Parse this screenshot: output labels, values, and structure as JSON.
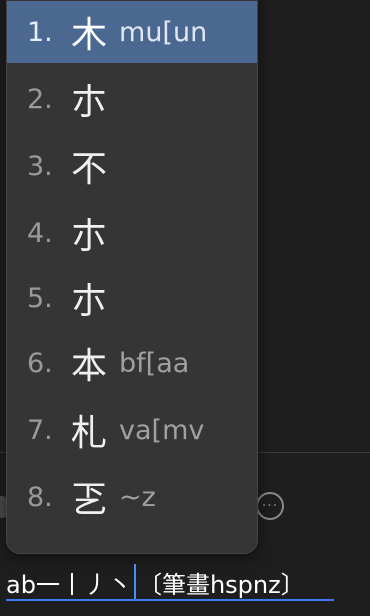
{
  "candidates": [
    {
      "num": "1.",
      "char": "木",
      "code": "mu[un",
      "selected": true
    },
    {
      "num": "2.",
      "char": "朩",
      "code": ""
    },
    {
      "num": "3.",
      "char": "不",
      "code": ""
    },
    {
      "num": "4.",
      "char": "朩",
      "code": ""
    },
    {
      "num": "5.",
      "char": "朩",
      "code": ""
    },
    {
      "num": "6.",
      "char": "本",
      "code": "bf[aa"
    },
    {
      "num": "7.",
      "char": "札",
      "code": "va[mv"
    },
    {
      "num": "8.",
      "char": "乤",
      "code": "~z"
    }
  ],
  "composition": {
    "before_caret": "ab一丨丿丶",
    "after_caret": "〔筆畫hspnz〕"
  },
  "background": {
    "more_icon_glyph": "···"
  },
  "colors": {
    "selected_bg": "#4a6890",
    "panel_bg": "#353535",
    "caret": "#4a8cff",
    "underline": "#3b7cf5"
  }
}
